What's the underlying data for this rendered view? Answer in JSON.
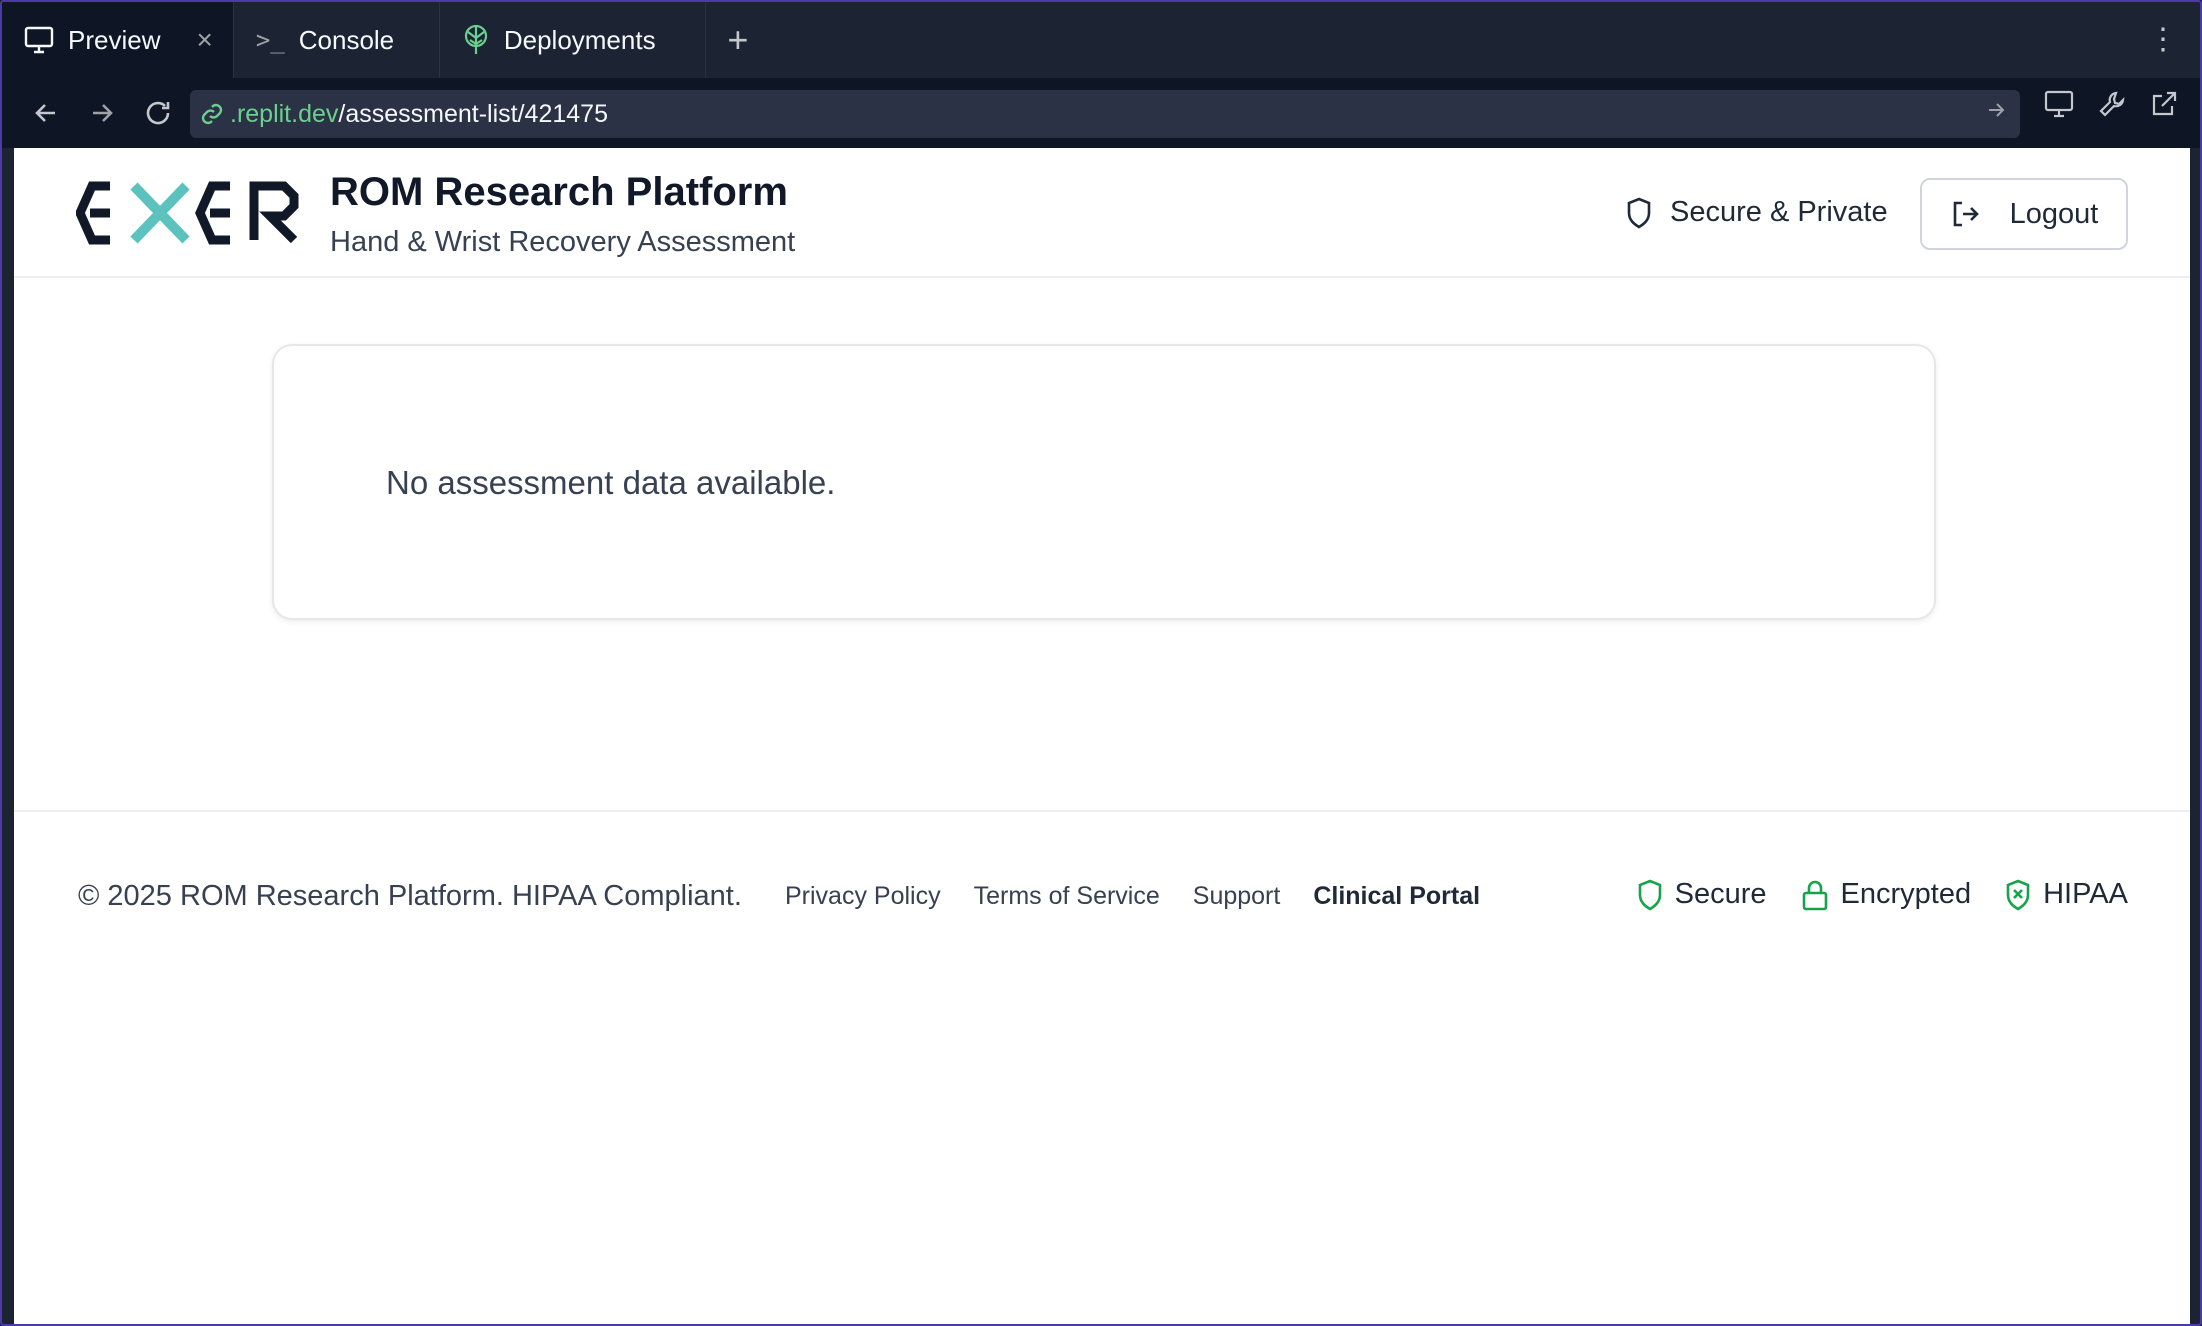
{
  "tabs": [
    {
      "label": "Preview",
      "icon": "monitor-icon",
      "active": true
    },
    {
      "label": "Console",
      "icon": "terminal-icon",
      "active": false
    },
    {
      "label": "Deployments",
      "icon": "deploy-icon",
      "active": false
    }
  ],
  "address": {
    "domain": ".replit.dev",
    "path": "/assessment-list/421475"
  },
  "header": {
    "title": "ROM Research Platform",
    "subtitle": "Hand & Wrist Recovery Assessment",
    "secure_label": "Secure & Private",
    "logout_label": "Logout"
  },
  "main": {
    "empty_message": "No assessment data available."
  },
  "footer": {
    "copyright": "© 2025 ROM Research Platform. HIPAA Compliant.",
    "links": [
      "Privacy Policy",
      "Terms of Service",
      "Support",
      "Clinical Portal"
    ],
    "badges": [
      "Secure",
      "Encrypted",
      "HIPAA"
    ]
  },
  "colors": {
    "accent_green": "#6ccf8e",
    "badge_green": "#16a34a",
    "logo_teal": "#5cc2bd",
    "frame_purple": "#4b3aa8"
  }
}
